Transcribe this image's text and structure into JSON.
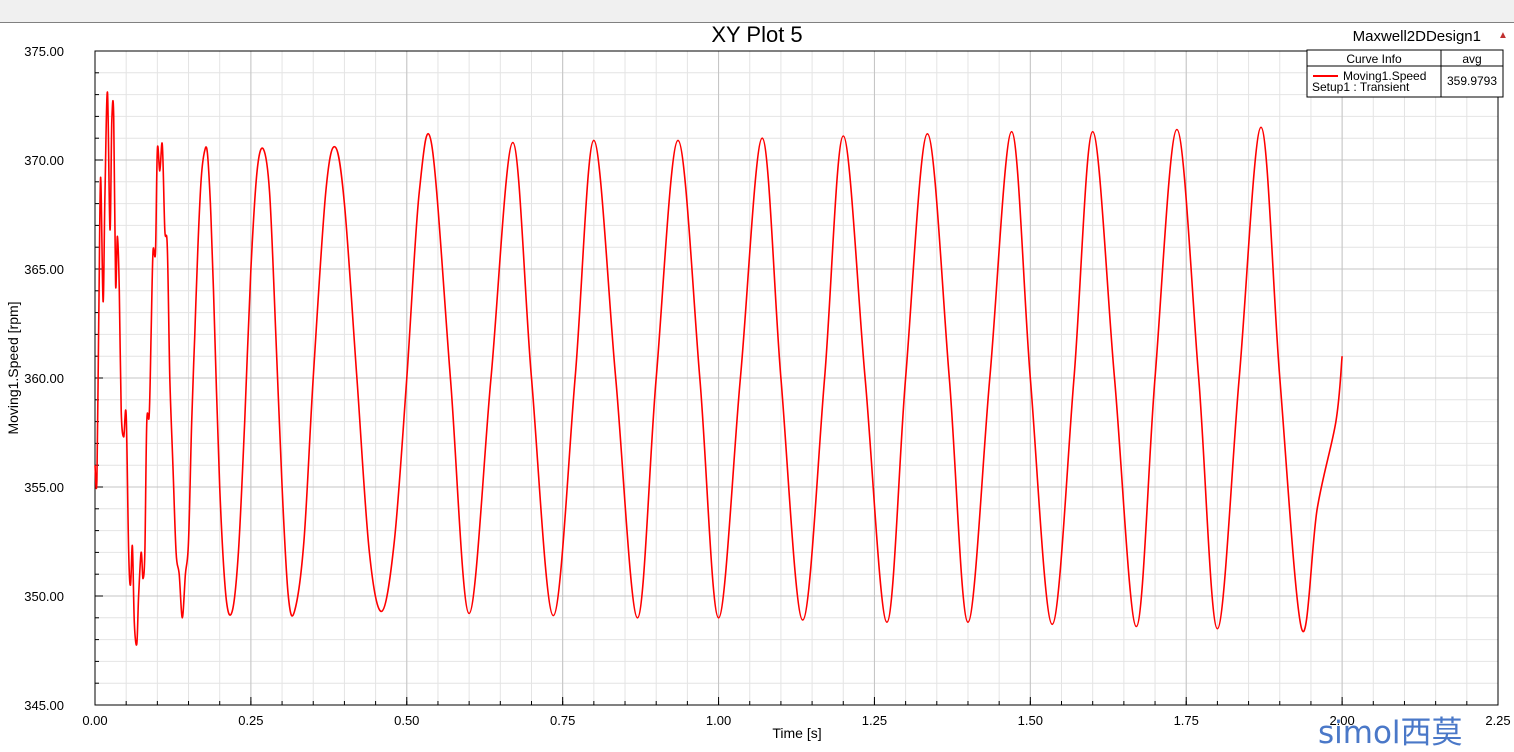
{
  "window": {
    "design_name": "Maxwell2DDesign1",
    "design_arrow_icon": "up-triangle-icon"
  },
  "legend": {
    "header_curve": "Curve Info",
    "header_stat": "avg",
    "curve_name": "Moving1.Speed",
    "curve_setup": "Setup1 : Transient",
    "curve_avg": "359.9793",
    "curve_color": "#ff0000"
  },
  "watermark": {
    "text": "simol西莫"
  },
  "chart_data": {
    "type": "line",
    "title": "XY Plot 5",
    "xlabel": "Time [s]",
    "ylabel": "Moving1.Speed [rpm]",
    "xlim": [
      0,
      2.25
    ],
    "ylim": [
      345,
      375
    ],
    "x_ticks": [
      "0.00",
      "0.25",
      "0.50",
      "0.75",
      "1.00",
      "1.25",
      "1.50",
      "1.75",
      "2.00",
      "2.25"
    ],
    "y_ticks": [
      "345.00",
      "350.00",
      "355.00",
      "360.00",
      "365.00",
      "370.00",
      "375.00"
    ],
    "grid": true,
    "legend_position": "top-right",
    "series": [
      {
        "name": "Moving1.Speed",
        "color": "#ff0000",
        "x": [
          0,
          0.003,
          0.006,
          0.009,
          0.013,
          0.016,
          0.02,
          0.024,
          0.027,
          0.03,
          0.033,
          0.036,
          0.039,
          0.042,
          0.046,
          0.05,
          0.054,
          0.057,
          0.06,
          0.063,
          0.067,
          0.07,
          0.074,
          0.077,
          0.08,
          0.083,
          0.087,
          0.09,
          0.093,
          0.097,
          0.1,
          0.104,
          0.108,
          0.112,
          0.116,
          0.12,
          0.125,
          0.13,
          0.135,
          0.14,
          0.145,
          0.15,
          0.155,
          0.16,
          0.165,
          0.17,
          0.175,
          0.18,
          0.185,
          0.19,
          0.2,
          0.21,
          0.22,
          0.23,
          0.24,
          0.25,
          0.26,
          0.27,
          0.28,
          0.29,
          0.3,
          0.31,
          0.32,
          0.335,
          0.35,
          0.37,
          0.385,
          0.4,
          0.42,
          0.44,
          0.46,
          0.48,
          0.5,
          0.52,
          0.54,
          0.57,
          0.6,
          0.635,
          0.67,
          0.7,
          0.735,
          0.77,
          0.8,
          0.835,
          0.87,
          0.9,
          0.935,
          0.97,
          1.0,
          1.035,
          1.07,
          1.1,
          1.135,
          1.17,
          1.2,
          1.235,
          1.27,
          1.3,
          1.335,
          1.37,
          1.4,
          1.435,
          1.47,
          1.5,
          1.535,
          1.57,
          1.6,
          1.635,
          1.67,
          1.7,
          1.735,
          1.77,
          1.8,
          1.835,
          1.87,
          1.9,
          1.935,
          1.96,
          1.99,
          2.0
        ],
        "y": [
          356.0,
          355.3,
          362.5,
          369.2,
          363.5,
          368.5,
          373.1,
          366.8,
          371.8,
          372.0,
          364.3,
          366.5,
          364.0,
          358.5,
          357.3,
          358.3,
          352.0,
          350.5,
          352.3,
          348.8,
          347.8,
          350.0,
          352.0,
          350.8,
          352.1,
          358.0,
          358.3,
          362.0,
          365.8,
          365.8,
          370.5,
          369.5,
          370.7,
          366.8,
          366.0,
          360.0,
          356.0,
          352.0,
          351.0,
          349.0,
          351.0,
          352.5,
          358.0,
          362.0,
          366.0,
          369.0,
          370.3,
          370.4,
          368.0,
          364.0,
          355.0,
          350.0,
          349.3,
          352.0,
          358.0,
          365.0,
          369.5,
          370.5,
          368.5,
          362.0,
          355.0,
          350.0,
          349.3,
          352.5,
          360.0,
          368.5,
          370.6,
          368.0,
          360.0,
          352.0,
          349.3,
          352.5,
          360.0,
          368.5,
          370.7,
          360.0,
          349.2,
          360.0,
          370.8,
          360.0,
          349.1,
          360.0,
          370.9,
          360.0,
          349.0,
          360.0,
          370.9,
          360.0,
          349.0,
          360.0,
          371.0,
          360.0,
          348.9,
          360.0,
          371.1,
          360.0,
          348.8,
          360.0,
          371.2,
          360.0,
          348.8,
          360.0,
          371.3,
          360.0,
          348.7,
          360.0,
          371.3,
          360.0,
          348.6,
          360.0,
          371.4,
          360.0,
          348.5,
          360.0,
          371.5,
          360.0,
          348.5,
          354.0,
          358.0,
          361.0
        ]
      }
    ]
  }
}
